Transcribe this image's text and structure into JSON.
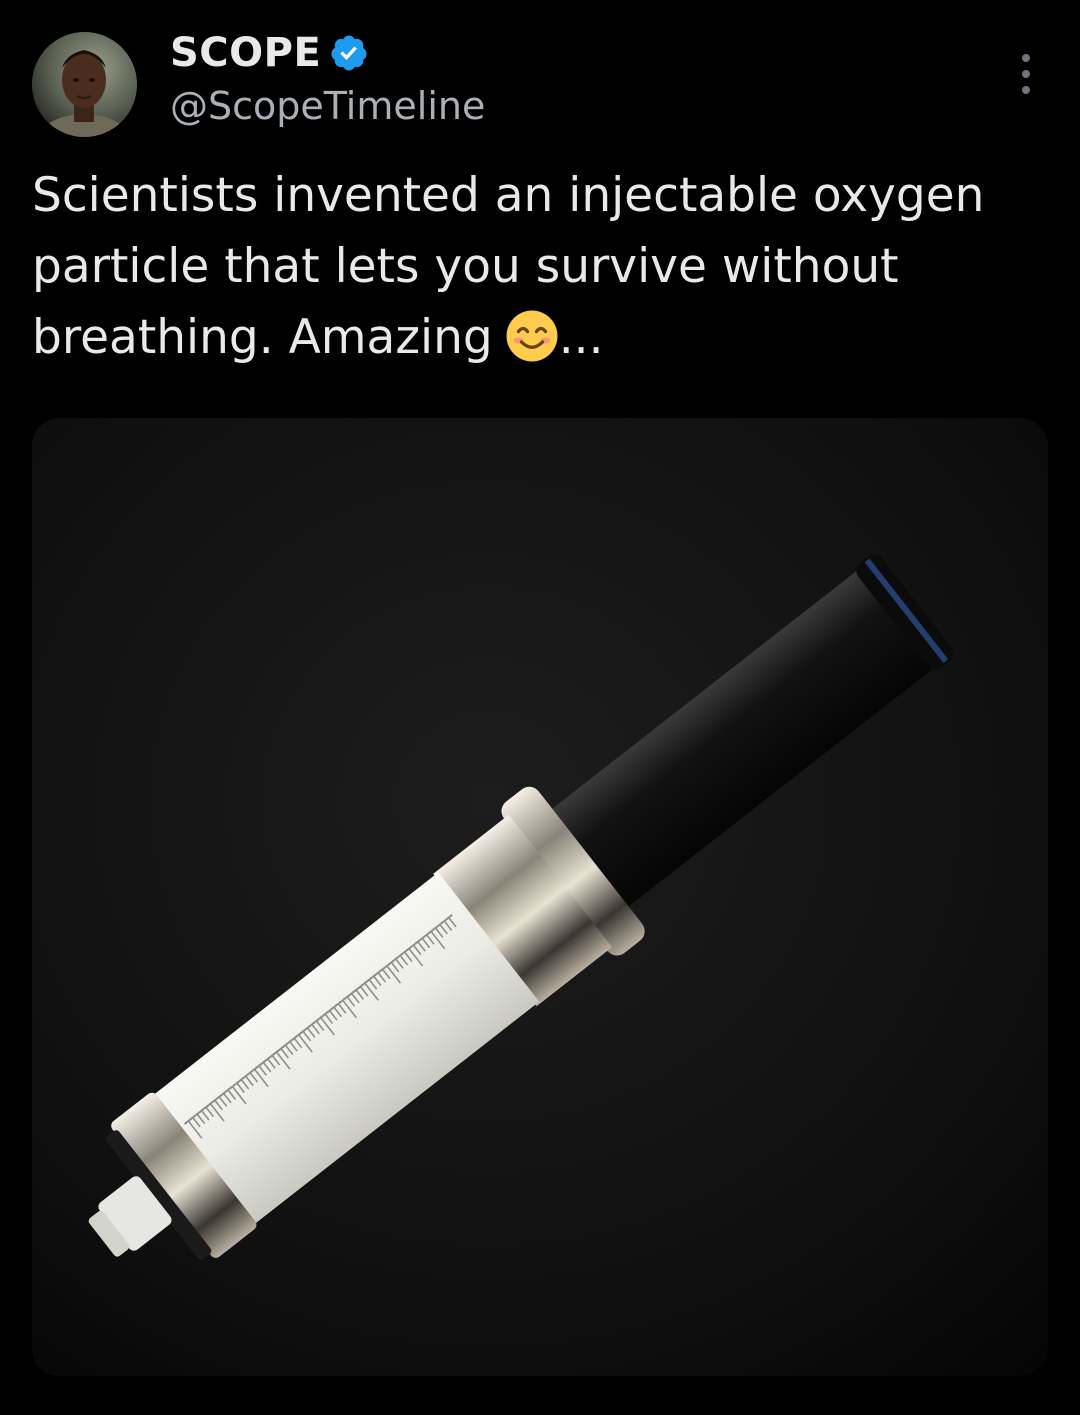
{
  "tweet": {
    "author": {
      "display_name": "SCOPE",
      "handle": "@ScopeTimeline",
      "verified": true,
      "verified_color": "#1d9bf0",
      "avatar_icon": "avatar-photo"
    },
    "text": "Scientists invented an injectable oxygen particle that lets you survive without breathing. Amazing",
    "emoji": "smiling-face-with-smiling-eyes",
    "text_suffix": "...",
    "media": {
      "description_icon": "syringe-photo"
    },
    "more_icon": "more-vertical-icon"
  },
  "colors": {
    "background": "#000000",
    "text_primary": "#e7e9ea",
    "text_secondary": "#aab0b6",
    "accent": "#1d9bf0"
  }
}
